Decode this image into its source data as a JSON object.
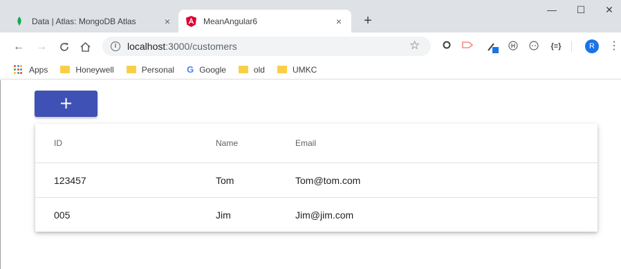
{
  "browser": {
    "tabs": [
      {
        "title": "Data | Atlas: MongoDB Atlas",
        "active": false,
        "icon": "mongodb-leaf-icon"
      },
      {
        "title": "MeanAngular6",
        "active": true,
        "icon": "angular-icon"
      }
    ],
    "close_glyph": "×",
    "new_tab_glyph": "+",
    "window_controls": {
      "minimize": "—",
      "maximize": "☐",
      "close": "✕"
    },
    "address": {
      "host": "localhost",
      "path": ":3000/customers"
    },
    "avatar_letter": "R",
    "bookmarks": [
      {
        "label": "Apps",
        "icon": "apps-grid-icon"
      },
      {
        "label": "Honeywell",
        "icon": "folder-icon"
      },
      {
        "label": "Personal",
        "icon": "folder-icon"
      },
      {
        "label": "Google",
        "icon": "google-icon"
      },
      {
        "label": "old",
        "icon": "folder-icon"
      },
      {
        "label": "UMKC",
        "icon": "folder-icon"
      }
    ]
  },
  "page": {
    "add_button_label": "+",
    "table": {
      "headers": {
        "id": "ID",
        "name": "Name",
        "email": "Email"
      },
      "rows": [
        {
          "id": "123457",
          "name": "Tom",
          "email": "Tom@tom.com"
        },
        {
          "id": "005",
          "name": "Jim",
          "email": "Jim@jim.com"
        }
      ]
    }
  },
  "colors": {
    "primary": "#3f51b5",
    "tab_strip": "#dee1e6",
    "folder": "#f9cf48",
    "avatar": "#1a73e8"
  }
}
